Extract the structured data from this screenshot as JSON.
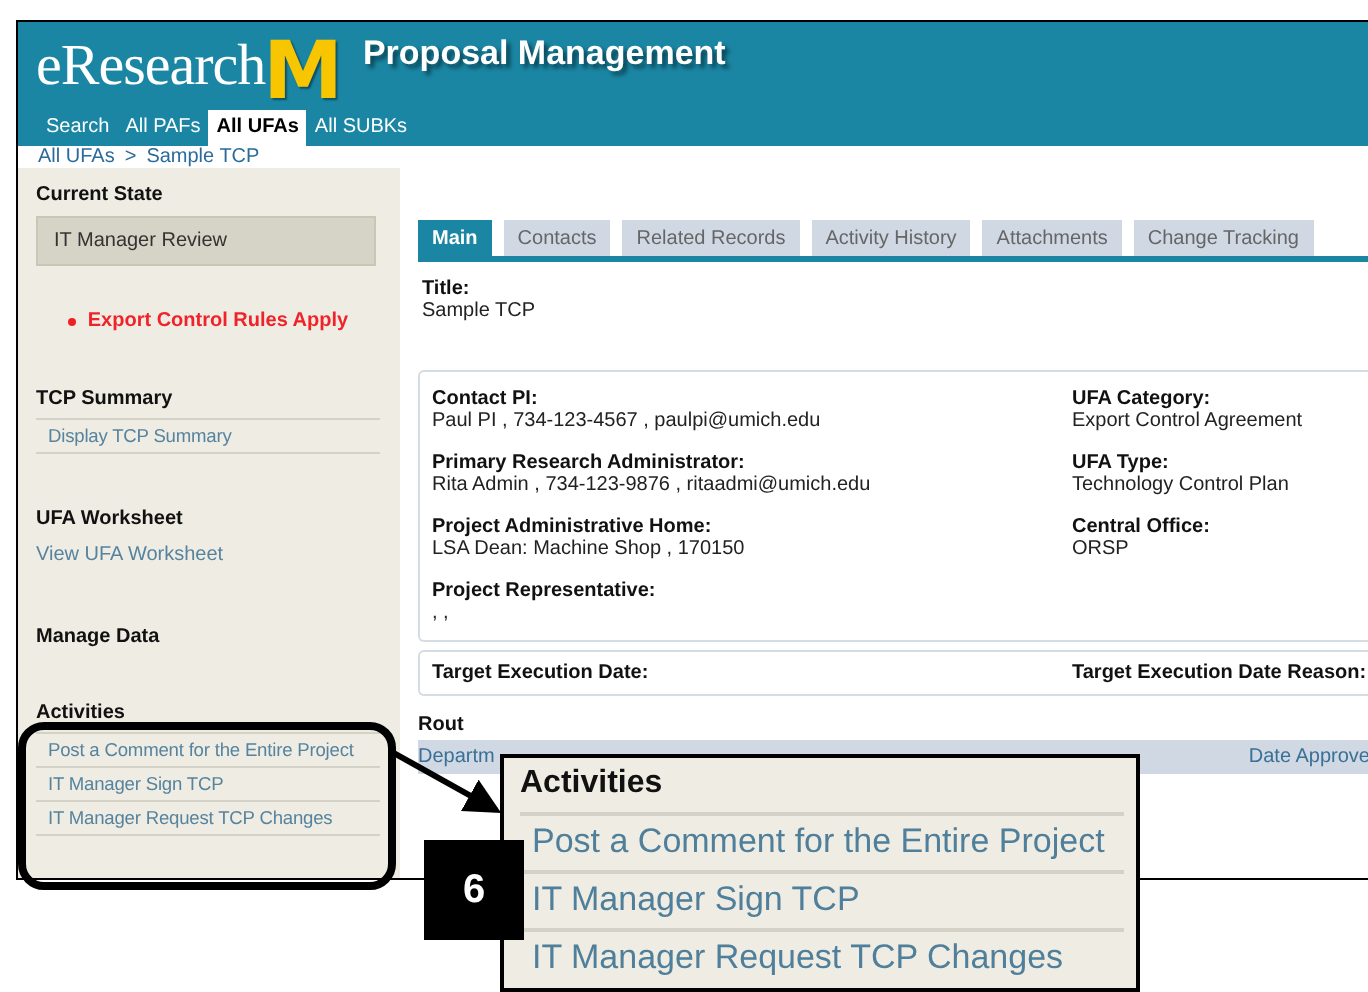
{
  "header": {
    "logo_text": "eResearch",
    "logo_mark": "M",
    "title": "Proposal Management"
  },
  "nav_tabs": [
    {
      "label": "Search",
      "selected": false
    },
    {
      "label": "All PAFs",
      "selected": false
    },
    {
      "label": "All UFAs",
      "selected": true
    },
    {
      "label": "All SUBKs",
      "selected": false
    }
  ],
  "breadcrumb": {
    "items": [
      "All UFAs",
      "Sample TCP"
    ],
    "separator": ">"
  },
  "sidebar": {
    "current_state": {
      "heading": "Current State",
      "value": "IT Manager Review"
    },
    "alert": "Export Control Rules Apply",
    "sections": [
      {
        "heading": "TCP Summary",
        "kind": "boxed",
        "links": [
          "Display TCP Summary"
        ]
      },
      {
        "heading": "UFA Worksheet",
        "kind": "plain",
        "links": [
          "View UFA Worksheet"
        ]
      },
      {
        "heading": "Manage Data",
        "kind": "plain"
      },
      {
        "heading": "Activities",
        "kind": "boxed",
        "links": [
          "Post a Comment for the Entire Project",
          "IT Manager Sign TCP",
          "IT Manager Request TCP Changes"
        ]
      }
    ]
  },
  "tabs": [
    {
      "label": "Main",
      "selected": true
    },
    {
      "label": "Contacts",
      "selected": false
    },
    {
      "label": "Related Records",
      "selected": false
    },
    {
      "label": "Activity History",
      "selected": false
    },
    {
      "label": "Attachments",
      "selected": false
    },
    {
      "label": "Change Tracking",
      "selected": false
    }
  ],
  "title_field": {
    "label": "Title:",
    "value": "Sample TCP"
  },
  "details": {
    "left": [
      {
        "label": "Contact PI:",
        "value": "Paul PI  , 734-123-4567 , paulpi@umich.edu"
      },
      {
        "label": "Primary Research Administrator:",
        "value": "Rita Admin  , 734-123-9876  , ritaadmi@umich.edu"
      },
      {
        "label": "Project Administrative Home:",
        "value": "LSA Dean: Machine Shop ,   170150"
      },
      {
        "label": "Project Representative:",
        "value": ",  ,"
      }
    ],
    "right": [
      {
        "label": "UFA Category:",
        "value": "Export Control Agreement"
      },
      {
        "label": "UFA Type:",
        "value": "Technology Control Plan"
      },
      {
        "label": "Central Office:",
        "value": "ORSP"
      }
    ]
  },
  "target": {
    "left": "Target Execution Date:",
    "right": "Target Execution Date Reason:"
  },
  "routing": {
    "heading": "Rout",
    "columns": [
      "Departm",
      "Date Approve"
    ]
  },
  "callout": {
    "number": "6",
    "heading": "Activities",
    "items": [
      "Post a Comment for the Entire Project",
      "IT Manager Sign TCP",
      "IT Manager Request TCP Changes"
    ]
  }
}
